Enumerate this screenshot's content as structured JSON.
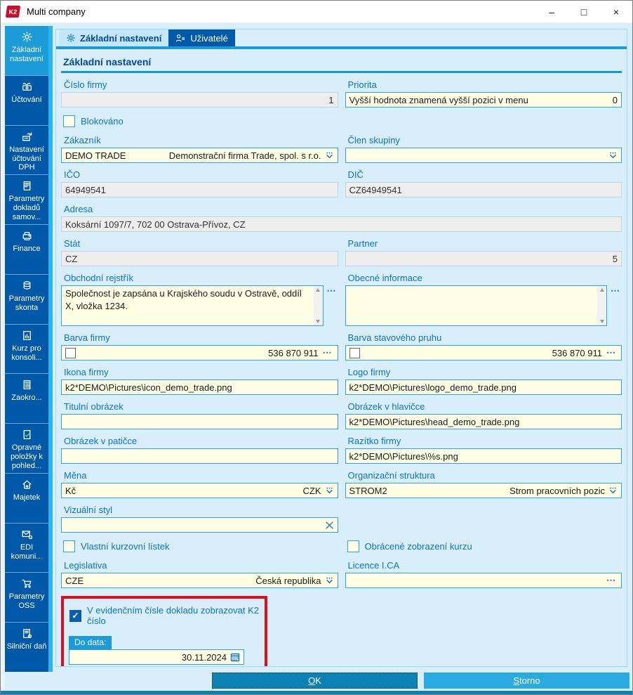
{
  "window": {
    "title": "Multi company"
  },
  "icons": {
    "k2_logo": "K2",
    "minimize": "–",
    "maximize": "□",
    "close": "×",
    "ellipsis": "⋯",
    "check": "✓"
  },
  "sidebar": {
    "items": [
      {
        "label": "Základní nastavení",
        "icon": "gear-icon",
        "active": true
      },
      {
        "label": "Účtování",
        "icon": "cash-register-icon",
        "active": false
      },
      {
        "label": "Nastavení účtování DPH",
        "icon": "vat-refresh-icon",
        "active": false
      },
      {
        "label": "Parametry dokladů samov...",
        "icon": "document-lines-icon",
        "active": false
      },
      {
        "label": "Finance",
        "icon": "printer-icon",
        "active": false
      },
      {
        "label": "Parametry skonta",
        "icon": "coins-icon",
        "active": false
      },
      {
        "label": "Kurz pro konsoli...",
        "icon": "chart-document-icon",
        "active": false
      },
      {
        "label": "Zaokro...",
        "icon": "calculator-icon",
        "active": false
      },
      {
        "label": "Opravné položky k pohled...",
        "icon": "document-check-icon",
        "active": false
      },
      {
        "label": "Majetek",
        "icon": "house-arrow-icon",
        "active": false
      },
      {
        "label": "EDI komuni...",
        "icon": "mail-gear-icon",
        "active": false
      },
      {
        "label": "Parametry OSS",
        "icon": "cart-icon",
        "active": false
      },
      {
        "label": "Silniční daň",
        "icon": "document-gear-icon",
        "active": false
      }
    ]
  },
  "tabs": [
    {
      "label": "Základní nastavení",
      "active": true
    },
    {
      "label": "Uživatelé",
      "active": false
    }
  ],
  "section_title": "Základní nastavení",
  "form": {
    "cislo_firmy": {
      "label": "Číslo firmy",
      "value": "1"
    },
    "priorita": {
      "label": "Priorita",
      "text": "Vyšší hodnota znamená vyšší pozici v menu",
      "value": "0"
    },
    "blokovano": {
      "label": "Blokováno",
      "checked": false
    },
    "zakaznik": {
      "label": "Zákazník",
      "code": "DEMO TRADE",
      "name": "Demonstrační firma Trade, spol. s r.o."
    },
    "clen_skupiny": {
      "label": "Člen skupiny",
      "value": ""
    },
    "ico": {
      "label": "IČO",
      "value": "64949541"
    },
    "dic": {
      "label": "DIČ",
      "value": "CZ64949541"
    },
    "adresa": {
      "label": "Adresa",
      "value": "Koksární 1097/7, 702 00  Ostrava-Přívoz, CZ"
    },
    "stat": {
      "label": "Stát",
      "value": "CZ"
    },
    "partner": {
      "label": "Partner",
      "value": "5"
    },
    "obchodni_rejstrik": {
      "label": "Obchodní rejstřík",
      "value": "Společnost je zapsána u Krajského soudu v Ostravě, oddíl X, vložka 1234."
    },
    "obecne_informace": {
      "label": "Obecné informace",
      "value": ""
    },
    "barva_firmy": {
      "label": "Barva firmy",
      "value": "536 870 911",
      "swatch": "#ffffff"
    },
    "barva_stavoveho_pruhu": {
      "label": "Barva stavového pruhu",
      "value": "536 870 911",
      "swatch": "#ffffff"
    },
    "ikona_firmy": {
      "label": "Ikona firmy",
      "value": "k2*DEMO\\Pictures\\icon_demo_trade.png"
    },
    "logo_firmy": {
      "label": "Logo firmy",
      "value": "k2*DEMO\\Pictures\\logo_demo_trade.png"
    },
    "titulni_obrazek": {
      "label": "Titulní obrázek",
      "value": ""
    },
    "obrazek_v_hlavicce": {
      "label": "Obrázek v hlavičce",
      "value": "k2*DEMO\\Pictures\\head_demo_trade.png"
    },
    "obrazek_v_paticce": {
      "label": "Obrázek v patičce",
      "value": ""
    },
    "razitko_firmy": {
      "label": "Razítko firmy",
      "value": "k2*DEMO\\Pictures\\%s.png"
    },
    "mena": {
      "label": "Měna",
      "code": "Kč",
      "name": "CZK"
    },
    "organizacni_struktura": {
      "label": "Organizační struktura",
      "code": "STROM2",
      "name": "Strom pracovních pozic"
    },
    "vizualni_styl": {
      "label": "Vizuální styl",
      "value": ""
    },
    "vlastni_kurzovni_listek": {
      "label": "Vlastní kurzovní lístek",
      "checked": false
    },
    "obracene_zobrazeni_kurzu": {
      "label": "Obrácené zobrazení kurzu",
      "checked": false
    },
    "legislativa": {
      "label": "Legislativa",
      "code": "CZE",
      "name": "Česká republika"
    },
    "licence_ica": {
      "label": "Licence I.CA",
      "value": ""
    },
    "k2_cislo": {
      "label": "V evidenčním čísle dokladu zobrazovat K2 číslo",
      "checked": true
    },
    "do_data": {
      "label": "Do data:",
      "value": "30.11.2024"
    }
  },
  "buttons": {
    "ok": "OK",
    "storno": "Storno"
  },
  "colors": {
    "sidebar": "#0059A8",
    "sidebar_active": "#1B9BD8",
    "accent_cyan": "#29B5EF",
    "content_bg": "#D8EEFA",
    "field_yellow": "#FFFDE3",
    "field_disabled": "#EDEDED",
    "annotation_red": "#DE0F18",
    "ok_button": "#0C81B5",
    "storno_button": "#29ABE2"
  }
}
